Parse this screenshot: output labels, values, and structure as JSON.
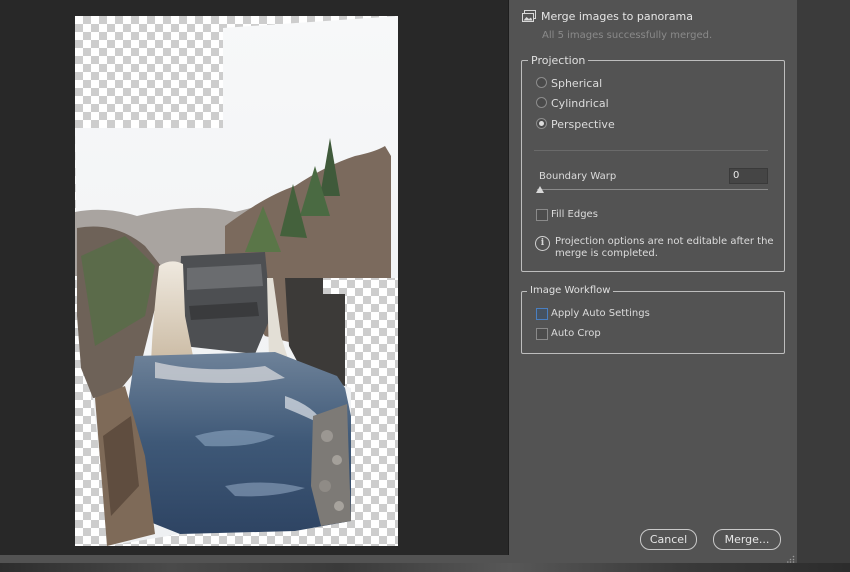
{
  "header": {
    "icon": "panorama-image-icon",
    "title": "Merge images to panorama",
    "subtitle": "All 5 images successfully merged."
  },
  "projection": {
    "group_title": "Projection",
    "options": [
      {
        "label": "Spherical",
        "selected": false
      },
      {
        "label": "Cylindrical",
        "selected": false
      },
      {
        "label": "Perspective",
        "selected": true
      }
    ],
    "boundary_warp_label": "Boundary Warp",
    "boundary_warp_value": "0",
    "boundary_warp_level": 0,
    "fill_edges_label": "Fill Edges",
    "fill_edges_checked": false,
    "info_text": "Projection options are not editable after the merge is completed."
  },
  "workflow": {
    "group_title": "Image Workflow",
    "apply_auto_settings_label": "Apply Auto Settings",
    "apply_auto_settings_checked": false,
    "auto_crop_label": "Auto Crop",
    "auto_crop_checked": false
  },
  "buttons": {
    "cancel": "Cancel",
    "merge": "Merge..."
  },
  "colors": {
    "panel_bg": "#535353",
    "preview_bg": "#282828",
    "focus_accent": "#4a7fc1"
  }
}
